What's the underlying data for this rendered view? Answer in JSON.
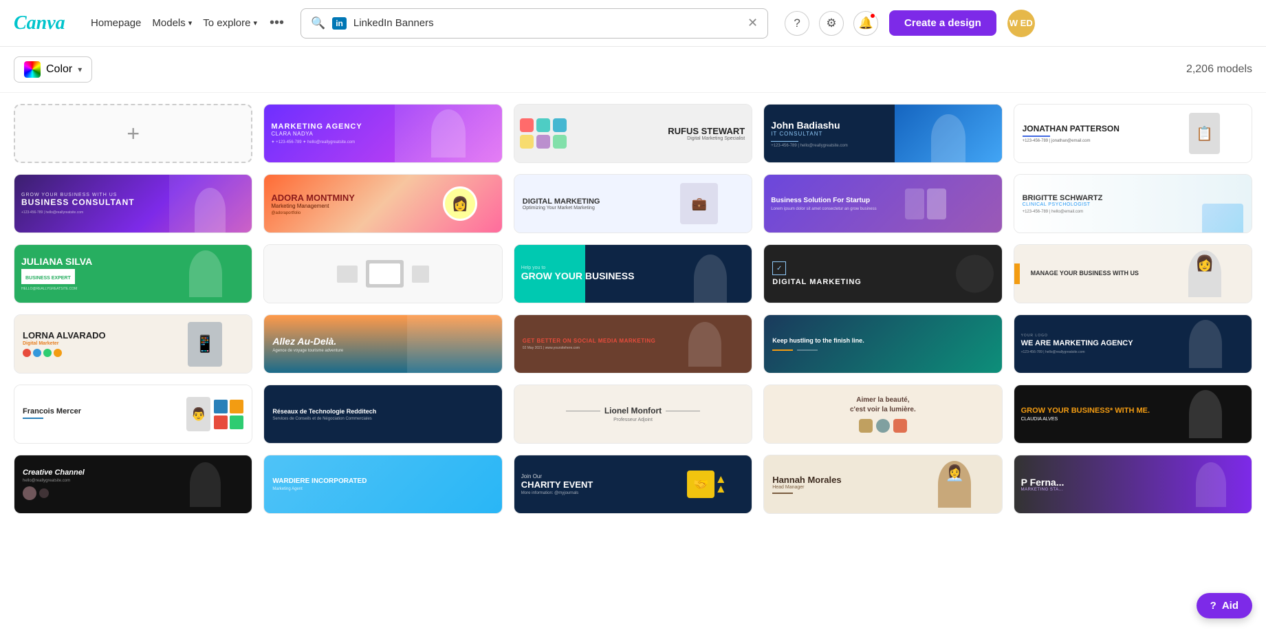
{
  "header": {
    "logo": "Canva",
    "nav": [
      {
        "label": "Homepage",
        "hasDropdown": false
      },
      {
        "label": "Models",
        "hasDropdown": true
      },
      {
        "label": "To explore",
        "hasDropdown": true
      }
    ],
    "more_btn": "•••",
    "search": {
      "placeholder": "LinkedIn Banners",
      "value": "LinkedIn Banners",
      "badge": "in"
    },
    "create_btn": "Create a design",
    "avatar_text": "W ED"
  },
  "toolbar": {
    "color_label": "Color",
    "models_count": "2,206 models"
  },
  "grid": {
    "add_card_icon": "+",
    "banners": [
      {
        "id": "marketing-agency",
        "style": "b1",
        "title": "MARKETING AGENCY",
        "sub": "CLARA NADYA",
        "has_photo": true
      },
      {
        "id": "rufus-stewart",
        "style": "b2",
        "title": "RUFUS STEWART",
        "sub": "Digital Marketing Specialist",
        "has_photo": false
      },
      {
        "id": "john-badiashu",
        "style": "b3",
        "title": "John Badiashu",
        "sub": "IT CONSULTANT",
        "has_photo": true
      },
      {
        "id": "jonathan-patterson",
        "style": "b4",
        "title": "JONATHAN PATTERSON",
        "sub": "",
        "has_photo": true
      },
      {
        "id": "business-consultant",
        "style": "b5",
        "title": "BUSINESS CONSULTANT",
        "sub": "GROW YOUR BUSINESS WITH US",
        "has_photo": true
      },
      {
        "id": "adora-montminy",
        "style": "b6",
        "title": "ADORA MONTMINY",
        "sub": "Marketing Management",
        "has_photo": true
      },
      {
        "id": "digital-marketing-1",
        "style": "b7",
        "title": "DIGITAL MARKETING",
        "sub": "Optimizing Your Market Marketing",
        "has_photo": true
      },
      {
        "id": "business-solution",
        "style": "b8",
        "title": "Business Solution For Startup",
        "sub": "",
        "has_photo": true
      },
      {
        "id": "brigitte-schwartz",
        "style": "b9",
        "title": "BRIGITTE SCHWARTZ",
        "sub": "CLINICAL PSYCHOLOGIST",
        "has_photo": false
      },
      {
        "id": "juliana-silva",
        "style": "b10",
        "title": "JULIANA SILVA",
        "sub": "BUSINESS EXPERT",
        "has_photo": true
      },
      {
        "id": "minimal-white",
        "style": "b11",
        "title": "",
        "sub": "",
        "has_photo": false
      },
      {
        "id": "grow-your-business",
        "style": "b12",
        "title": "GROW YOUR BUSINESS",
        "sub": "Help you to",
        "has_photo": true
      },
      {
        "id": "digital-marketing-2",
        "style": "b13",
        "title": "DIGITAL MARKETING",
        "sub": "",
        "has_photo": true
      },
      {
        "id": "manage-business",
        "style": "b14",
        "title": "MANAGE YOUR BUSINESS WITH US",
        "sub": "",
        "has_photo": true
      },
      {
        "id": "lorna-alvarado",
        "style": "b15",
        "title": "LORNA ALVARADO",
        "sub": "Digital Marketer",
        "has_photo": true
      },
      {
        "id": "allez-au-dela",
        "style": "b16",
        "title": "Allez Au-Delà.",
        "sub": "Agence de voyage tourisme adventure",
        "has_photo": true
      },
      {
        "id": "social-media",
        "style": "b17",
        "title": "GET BETTER ON SOCIAL MEDIA MARKETING",
        "sub": "",
        "has_photo": true
      },
      {
        "id": "keep-hustling",
        "style": "b18",
        "title": "Keep hustling to the finish line.",
        "sub": "",
        "has_photo": false
      },
      {
        "id": "we-are-marketing",
        "style": "b19",
        "title": "WE ARE MARKETING AGENCY",
        "sub": "",
        "has_photo": true
      },
      {
        "id": "francois-mercer",
        "style": "b20",
        "title": "Francois Mercer",
        "sub": "",
        "has_photo": true
      },
      {
        "id": "reseaux",
        "style": "b21",
        "title": "Réseaux de Technologie Redditech",
        "sub": "Services de Conseils et de Négociation Commerciales",
        "has_photo": false
      },
      {
        "id": "lionel-monfort",
        "style": "b22",
        "title": "Lionel Monfort",
        "sub": "Professeur Adjoint",
        "has_photo": false
      },
      {
        "id": "aimer-beaute",
        "style": "b23",
        "title": "Aimer la beauté, c'est voir la lumière.",
        "sub": "",
        "has_photo": false
      },
      {
        "id": "grow-business-dark",
        "style": "b24",
        "title": "GROW YOUR BUSINESS* WITH ME.",
        "sub": "CLAUDIA ALVES",
        "has_photo": true
      },
      {
        "id": "creative-channel",
        "style": "b25",
        "title": "Creative Channel",
        "sub": "",
        "has_photo": true
      },
      {
        "id": "wardiere",
        "style": "b26",
        "title": "WARDIERE INCORPORATED",
        "sub": "Marketing Agent",
        "has_photo": false
      },
      {
        "id": "charity-event",
        "style": "b27",
        "title": "Join Our CHARITY EVENT",
        "sub": "",
        "has_photo": true
      },
      {
        "id": "hannah-morales",
        "style": "b28",
        "title": "Hannah Morales",
        "sub": "Head Manager",
        "has_photo": true
      },
      {
        "id": "purple-partial",
        "style": "b29",
        "title": "P Ferna...",
        "sub": "MARKETING STA...",
        "has_photo": true
      }
    ]
  },
  "aid": {
    "label": "Aid",
    "icon": "?"
  }
}
